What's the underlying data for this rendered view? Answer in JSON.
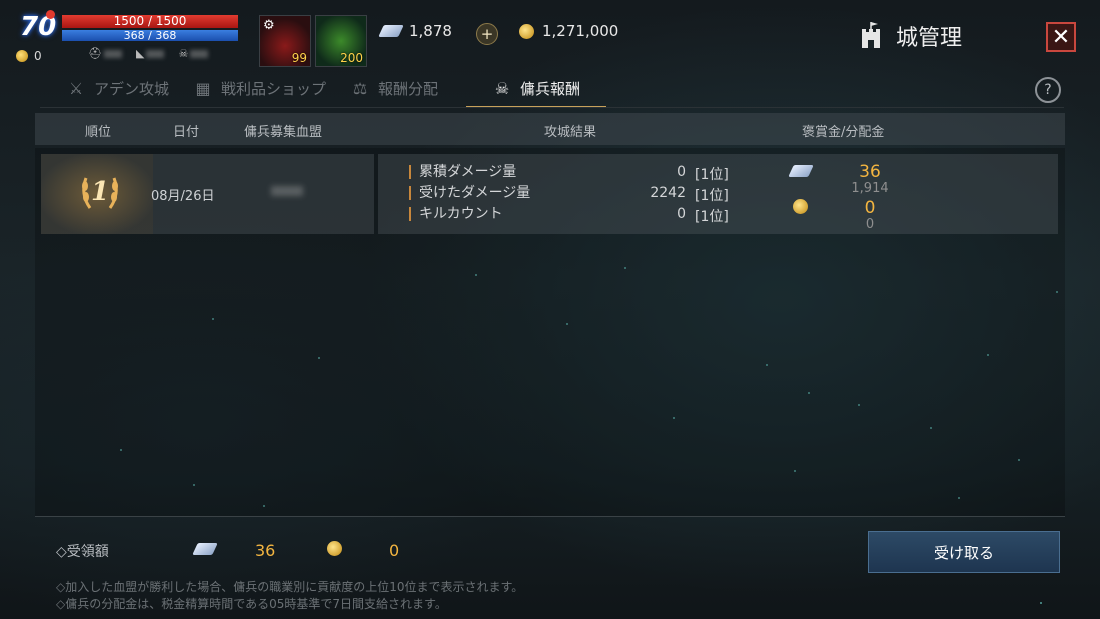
{
  "hud": {
    "level": "70",
    "hp": "1500 / 1500",
    "mp": "368 / 368",
    "small_coin": "0",
    "potion_count": "99",
    "leaf_count": "200",
    "crystal_amount": "1,878",
    "gold_amount": "1,271,000",
    "page_title": "城管理"
  },
  "tabs": [
    {
      "label": "アデン攻城",
      "icon": "crossed-swords-icon",
      "active": false
    },
    {
      "label": "戦利品ショップ",
      "icon": "chest-icon",
      "active": false
    },
    {
      "label": "報酬分配",
      "icon": "scales-icon",
      "active": false
    },
    {
      "label": "傭兵報酬",
      "icon": "mercenary-skull-icon",
      "active": true
    }
  ],
  "table": {
    "headers": {
      "rank": "順位",
      "date": "日付",
      "clan": "傭兵募集血盟",
      "result": "攻城結果",
      "reward": "褒賞金/分配金"
    },
    "row": {
      "rank": "1",
      "date": "08月/26日",
      "stats": [
        {
          "label": "累積ダメージ量",
          "value": "0",
          "rank": "[1位]"
        },
        {
          "label": "受けたダメージ量",
          "value": "2242",
          "rank": "[1位]"
        },
        {
          "label": "キルカウント",
          "value": "0",
          "rank": "[1位]"
        }
      ],
      "crystal_reward": "36",
      "crystal_sub": "1,914",
      "gold_reward": "0",
      "gold_sub": "0"
    }
  },
  "footer": {
    "received_label": "◇受領額",
    "received_crystal": "36",
    "received_gold": "0",
    "claim_button": "受け取る",
    "note1": "◇加入した血盟が勝利した場合、傭兵の職業別に貢献度の上位10位まで表示されます。",
    "note2": "◇傭兵の分配金は、税金精算時間である05時基準で7日間支給されます。"
  },
  "colors": {
    "accent_gold": "#f3b540",
    "hp": "#e23b30",
    "mp": "#3a7ee0",
    "close_border": "#c9473e"
  }
}
